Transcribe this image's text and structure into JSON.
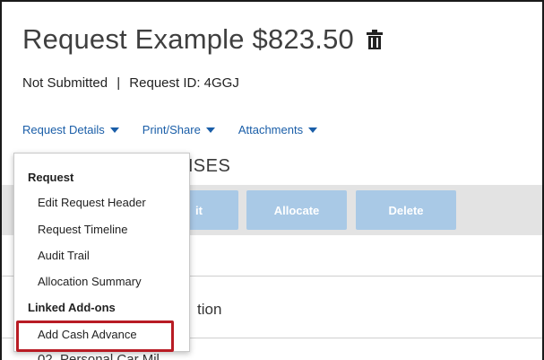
{
  "header": {
    "title": "Request Example $823.50",
    "status": "Not Submitted",
    "separator": "|",
    "request_id": "Request ID: 4GGJ"
  },
  "menu": {
    "request_details": "Request Details",
    "print_share": "Print/Share",
    "attachments": "Attachments"
  },
  "section": {
    "heading_partial": "ENSES"
  },
  "toolbar": {
    "edit_partial": "it",
    "allocate": "Allocate",
    "delete": "Delete"
  },
  "rows": {
    "row1_partial": "tion",
    "row2_partial": "02. Personal Car Mil"
  },
  "dropdown": {
    "group_request": "Request",
    "items": [
      "Edit Request Header",
      "Request Timeline",
      "Audit Trail",
      "Allocation Summary"
    ],
    "group_linked": "Linked Add-ons",
    "add_cash_advance": "Add Cash Advance"
  },
  "colors": {
    "link": "#1a5ea8",
    "button_disabled": "#a9c9e6",
    "highlight": "#b81c24",
    "toolbar_bg": "#e3e3e3"
  }
}
